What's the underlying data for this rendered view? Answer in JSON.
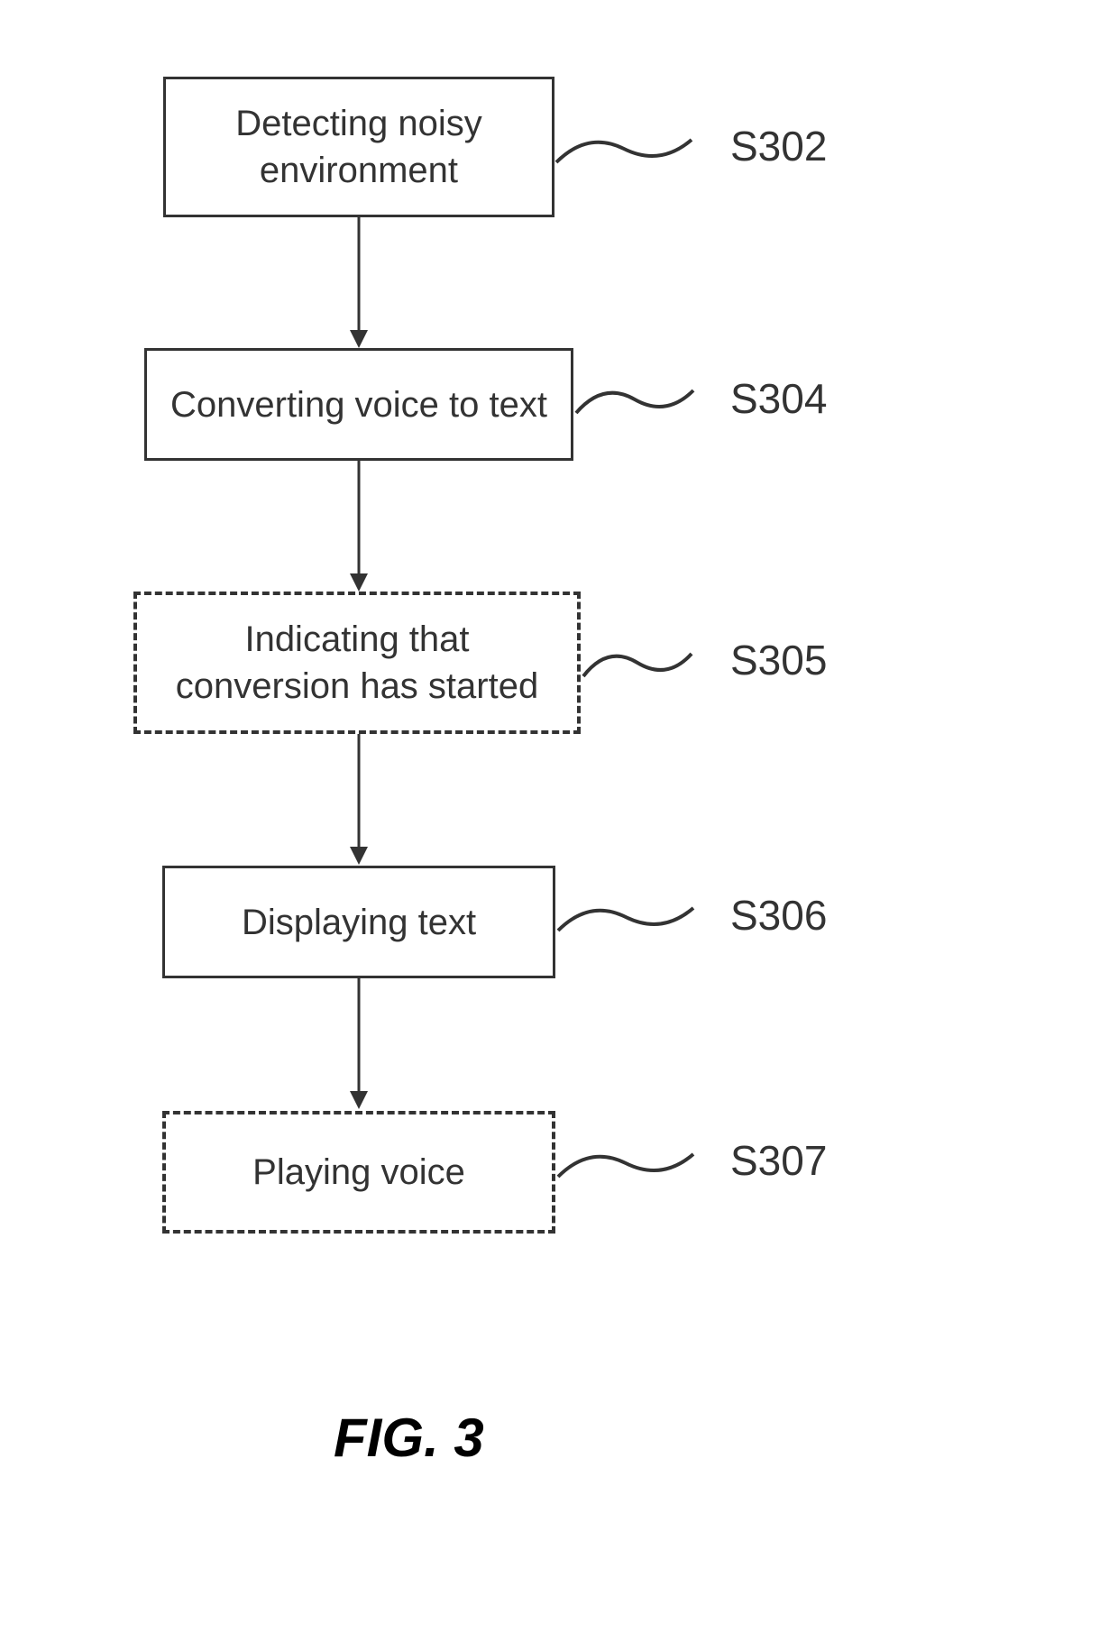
{
  "flowchart": {
    "steps": [
      {
        "id": "S302",
        "text": "Detecting noisy\nenvironment",
        "dashed": false
      },
      {
        "id": "S304",
        "text": "Converting voice to text",
        "dashed": false
      },
      {
        "id": "S305",
        "text": "Indicating that\nconversion has started",
        "dashed": true
      },
      {
        "id": "S306",
        "text": "Displaying text",
        "dashed": false
      },
      {
        "id": "S307",
        "text": "Playing voice",
        "dashed": true
      }
    ],
    "figure_label": "FIG. 3"
  }
}
